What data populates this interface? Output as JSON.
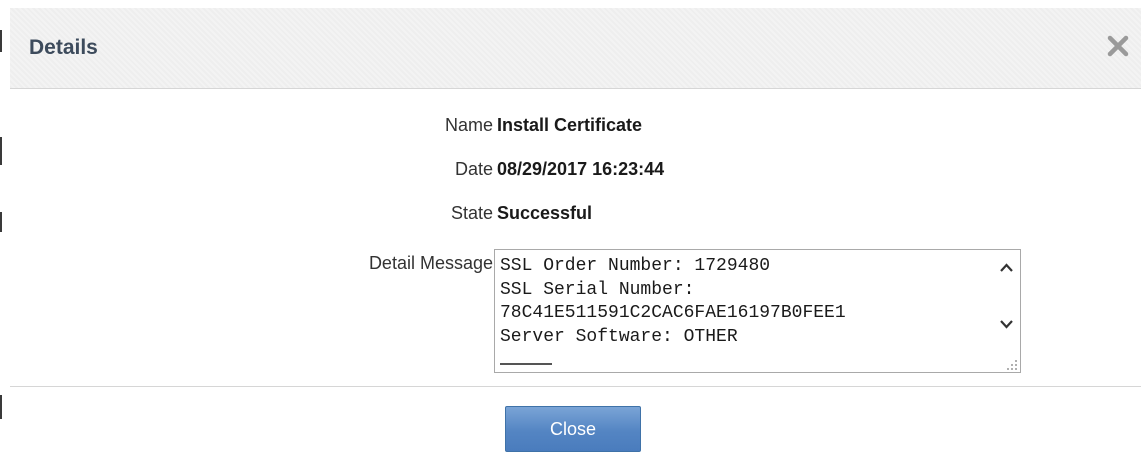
{
  "dialog": {
    "title": "Details",
    "close_icon": "close-x-icon"
  },
  "fields": {
    "name_label": "Name",
    "name_value": "Install Certificate",
    "date_label": "Date",
    "date_value": "08/29/2017 16:23:44",
    "state_label": "State",
    "state_value": "Successful",
    "detail_label": "Detail Message",
    "detail_lines": [
      "SSL Order Number: 1729480",
      "SSL Serial Number:",
      "78C41E511591C2CAC6FAE16197B0FEE1",
      "Server Software: OTHER"
    ]
  },
  "footer": {
    "close_label": "Close"
  },
  "colors": {
    "title_text": "#3d4b5c",
    "button_blue": "#5485c3",
    "border_gray": "#d6d6d6"
  }
}
